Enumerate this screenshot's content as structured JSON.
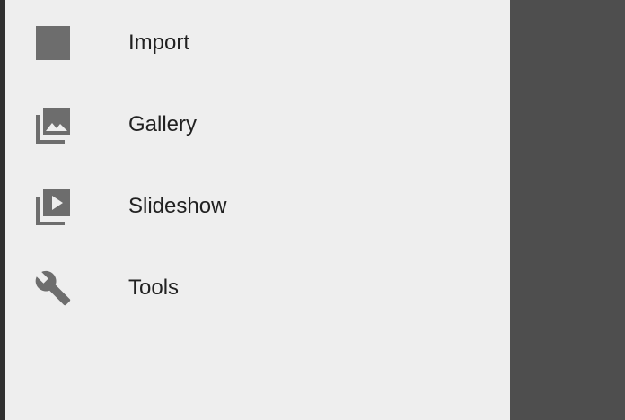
{
  "drawer": {
    "items": [
      {
        "label": "Import",
        "icon": "import-icon"
      },
      {
        "label": "Gallery",
        "icon": "gallery-icon"
      },
      {
        "label": "Slideshow",
        "icon": "slideshow-icon"
      },
      {
        "label": "Tools",
        "icon": "wrench-icon"
      }
    ]
  },
  "colors": {
    "drawer_background": "#eeeeee",
    "scrim": "#4e4e4e",
    "icon": "#6d6d6d",
    "text": "#212121"
  }
}
